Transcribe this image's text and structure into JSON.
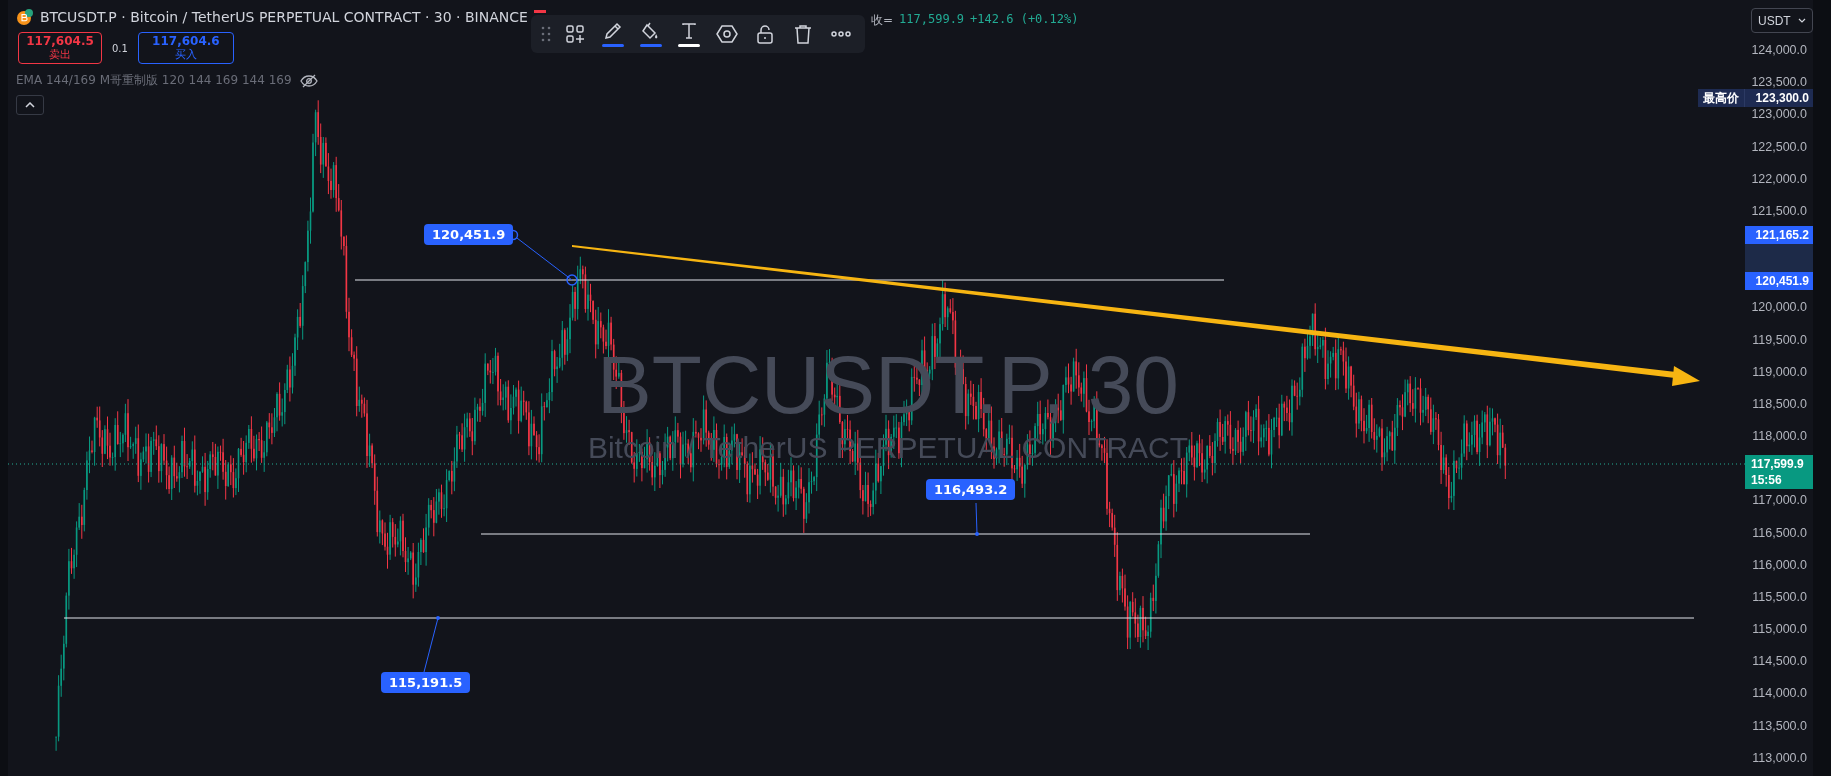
{
  "header": {
    "symbol_title": "BTCUSDT.P · Bitcoin / TetherUS PERPETUAL CONTRACT · 30 · BINANCE",
    "close_label": "收=",
    "close_value": "117,599.9",
    "change": "+142.6 (+0.12%)"
  },
  "trade": {
    "sell": {
      "price": "117,604.5",
      "label": "卖出"
    },
    "spread": "0.1",
    "buy": {
      "price": "117,604.6",
      "label": "买入"
    }
  },
  "indicator": {
    "text": "EMA 144/169 M哥重制版 120 144 169 144 169",
    "hidden": true
  },
  "toolbar": {
    "tools": [
      {
        "kind": "drag"
      },
      {
        "kind": "template"
      },
      {
        "kind": "line_color",
        "color": "#2962ff"
      },
      {
        "kind": "fill_color",
        "color": "#2962ff"
      },
      {
        "kind": "text_color",
        "color": "#ffffff"
      },
      {
        "kind": "settings"
      },
      {
        "kind": "lock"
      },
      {
        "kind": "delete"
      },
      {
        "kind": "more"
      }
    ]
  },
  "currency": "USDT",
  "watermark": {
    "symbol": "BTCUSDT.P, 30",
    "description": "Bitcoin / TetherUS PERPETUAL CONTRACT"
  },
  "drawings": [
    {
      "kind": "price_line",
      "label": "120,451.9"
    },
    {
      "kind": "price_line",
      "label": "116,493.2"
    },
    {
      "kind": "price_line",
      "label": "115,191.5"
    },
    {
      "kind": "trend_arrow"
    }
  ],
  "price_axis": {
    "labels": [
      "124,000.0",
      "123,500.0",
      "123,000.0",
      "122,500.0",
      "122,000.0",
      "121,500.0",
      "120,000.0",
      "119,500.0",
      "119,000.0",
      "118,500.0",
      "118,000.0",
      "117,000.0",
      "116,500.0",
      "116,000.0",
      "115,500.0",
      "115,000.0",
      "114,500.0",
      "114,000.0",
      "113,500.0",
      "113,000.0"
    ]
  },
  "price_tags": [
    {
      "kind": "high",
      "caption": "最高价",
      "price": "123,300.0"
    },
    {
      "kind": "drawing",
      "price": "121,165.2"
    },
    {
      "kind": "drawing",
      "price": "120,451.9"
    },
    {
      "kind": "last",
      "price": "117,599.9",
      "countdown": "15:56"
    }
  ]
}
